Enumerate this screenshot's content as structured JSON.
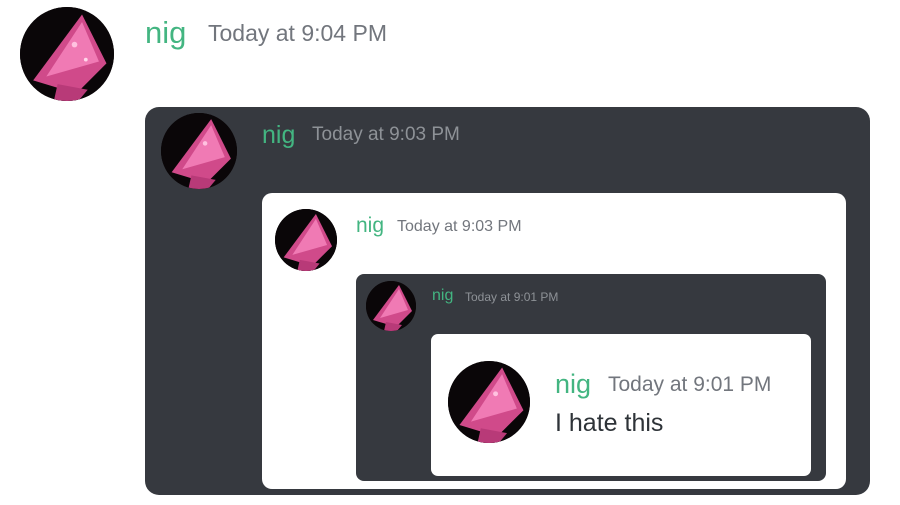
{
  "colors": {
    "username": "#43b581",
    "timestamp_on_light": "#72767d",
    "timestamp_on_dark": "#8e9297",
    "message_text": "#2e3338",
    "dark_panel": "#36393f",
    "light_panel": "#ffffff"
  },
  "messages": [
    {
      "username": "nig",
      "timestamp": "Today at 9:04 PM",
      "avatar_icon": "avatar-icon"
    },
    {
      "username": "nig",
      "timestamp": "Today at 9:03 PM",
      "avatar_icon": "avatar-icon"
    },
    {
      "username": "nig",
      "timestamp": "Today at 9:03 PM",
      "avatar_icon": "avatar-icon"
    },
    {
      "username": "nig",
      "timestamp": "Today at 9:01 PM",
      "avatar_icon": "avatar-icon"
    },
    {
      "username": "nig",
      "timestamp": "Today at 9:01 PM",
      "avatar_icon": "avatar-icon",
      "text": "I hate this"
    }
  ]
}
